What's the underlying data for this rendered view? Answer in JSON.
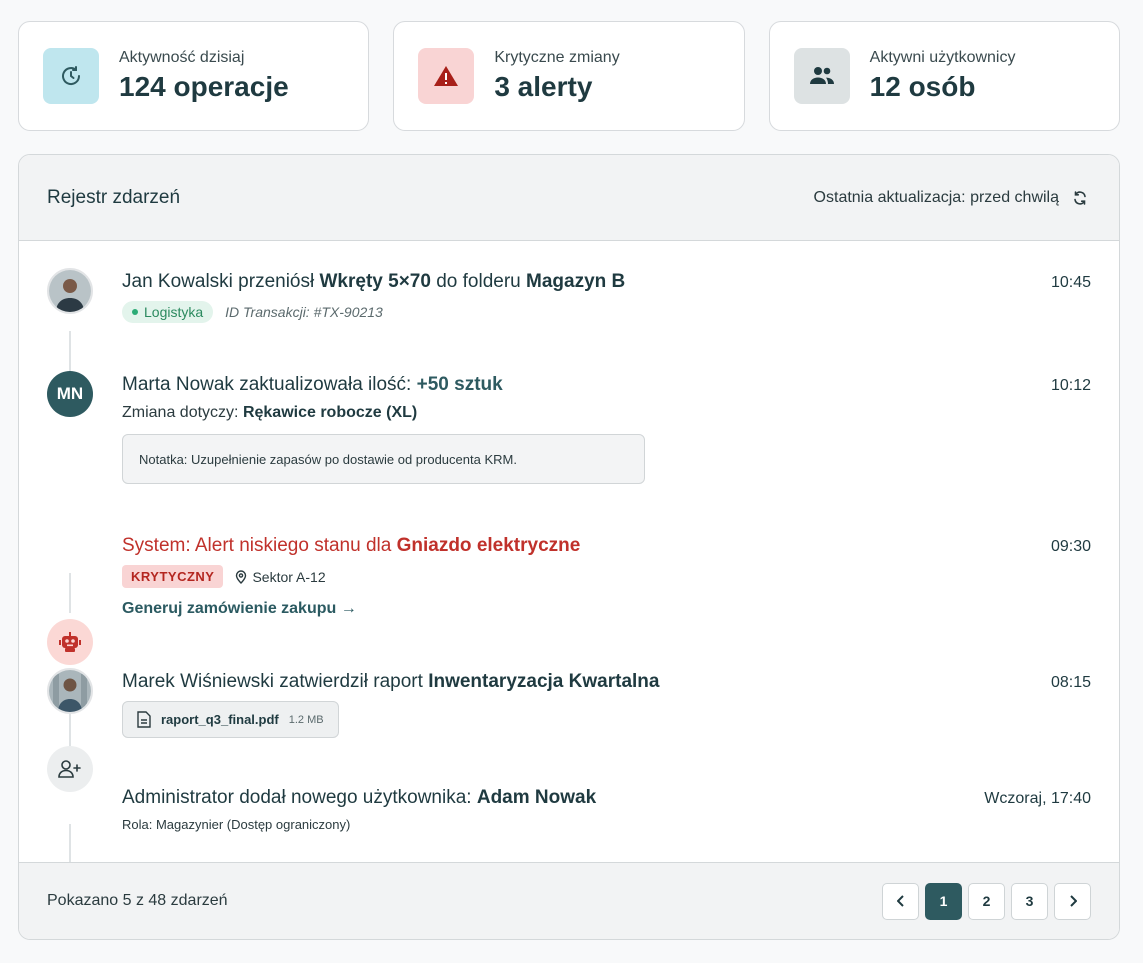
{
  "stats": [
    {
      "label": "Aktywność dzisiaj",
      "value": "124 operacje",
      "icon": "activity-clock-icon"
    },
    {
      "label": "Krytyczne zmiany",
      "value": "3 alerty",
      "icon": "warning-triangle-icon"
    },
    {
      "label": "Aktywni użytkownicy",
      "value": "12 osób",
      "icon": "users-icon"
    }
  ],
  "panel": {
    "title": "Rejestr zdarzeń",
    "last_update": "Ostatnia aktualizacja: przed chwilą"
  },
  "events": [
    {
      "actor": "Jan Kowalski",
      "verb": " przeniósł ",
      "object": "Wkręty 5×70",
      "mid": " do folderu ",
      "target": "Magazyn B",
      "time": "10:45",
      "tag": "Logistyka",
      "txid": "ID Transakcji: #TX-90213"
    },
    {
      "actor": "Marta Nowak",
      "initials": "MN",
      "verb": " zaktualizowała ilość: ",
      "qty": "+50 sztuk",
      "time": "10:12",
      "sub_prefix": "Zmiana dotyczy: ",
      "sub_item": "Rękawice robocze (XL)",
      "note": "Notatka: Uzupełnienie zapasów po dostawie od producenta KRM."
    },
    {
      "text": "System: Alert niskiego stanu dla ",
      "item": "Gniazdo elektryczne",
      "time": "09:30",
      "badge": "KRYTYCZNY",
      "location": "Sektor A-12",
      "action": "Generuj zamówienie zakupu →"
    },
    {
      "actor": "Marek Wiśniewski",
      "verb": " zatwierdził raport ",
      "object": "Inwentaryzacja Kwartalna",
      "time": "08:15",
      "file_name": "raport_q3_final.pdf",
      "file_size": "1.2 MB"
    },
    {
      "actor": "Administrator",
      "verb": " dodał nowego użytkownika: ",
      "object": "Adam Nowak",
      "time": "Wczoraj, 17:40",
      "role": "Rola: Magazynier (Dostęp ograniczony)"
    }
  ],
  "footer": {
    "summary": "Pokazano 5 z 48 zdarzeń",
    "pages": [
      "1",
      "2",
      "3"
    ],
    "current_page": "1"
  },
  "colors": {
    "accent": "#2e5a60",
    "critical": "#c0312b",
    "success": "#2bab76"
  }
}
